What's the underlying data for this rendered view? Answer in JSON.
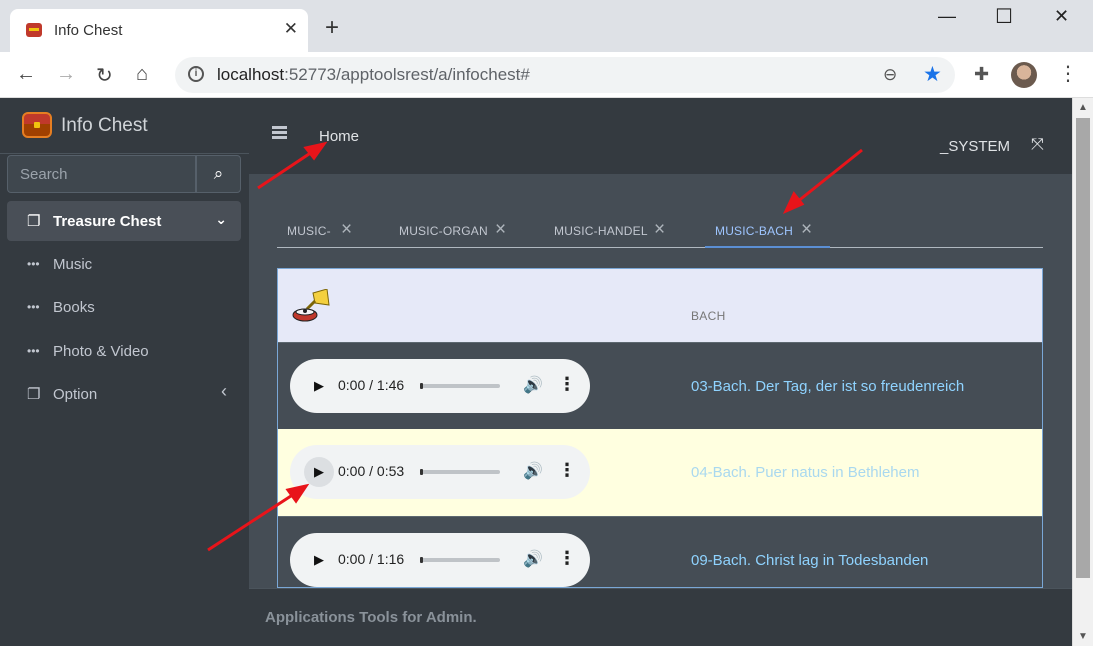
{
  "browser": {
    "tab_title": "Info Chest",
    "tab_close": "✕",
    "new_tab": "+",
    "url_host": "localhost",
    "url_rest": ":52773/apptoolsrest/a/infochest#",
    "win_min": "—",
    "win_max": "☐",
    "win_close": "✕"
  },
  "sidebar": {
    "brand": "Info Chest",
    "search_placeholder": "Search",
    "items": [
      {
        "label": "Treasure Chest",
        "icon": "copy-icon",
        "right": "⌄"
      },
      {
        "label": "Music",
        "icon": "ellipsis-icon"
      },
      {
        "label": "Books",
        "icon": "ellipsis-icon"
      },
      {
        "label": "Photo & Video",
        "icon": "ellipsis-icon"
      },
      {
        "label": "Option",
        "icon": "copy-icon",
        "right": "‹"
      }
    ]
  },
  "header": {
    "home": "Home",
    "user": "_SYSTEM"
  },
  "tabs": [
    {
      "label": "MUSIC-"
    },
    {
      "label": "MUSIC-ORGAN"
    },
    {
      "label": "MUSIC-HANDEL"
    },
    {
      "label": "MUSIC-BACH",
      "active": true
    }
  ],
  "panel": {
    "heading": "BACH",
    "tracks": [
      {
        "time": "0:00 / 1:46",
        "title": "03-Bach. Der Tag, der ist so freudenreich"
      },
      {
        "time": "0:00 / 0:53",
        "title": "04-Bach. Puer natus in Bethlehem"
      },
      {
        "time": "0:00 / 1:16",
        "title": "09-Bach. Christ lag in Todesbanden"
      }
    ]
  },
  "footer": {
    "text": "Applications Tools for Admin."
  },
  "colors": {
    "sidebar_bg": "#343a40",
    "content_bg": "#454d55",
    "active_tab": "#9ec5ff",
    "highlight_row": "#ffffe0",
    "annotation_arrow": "#e8141a"
  }
}
